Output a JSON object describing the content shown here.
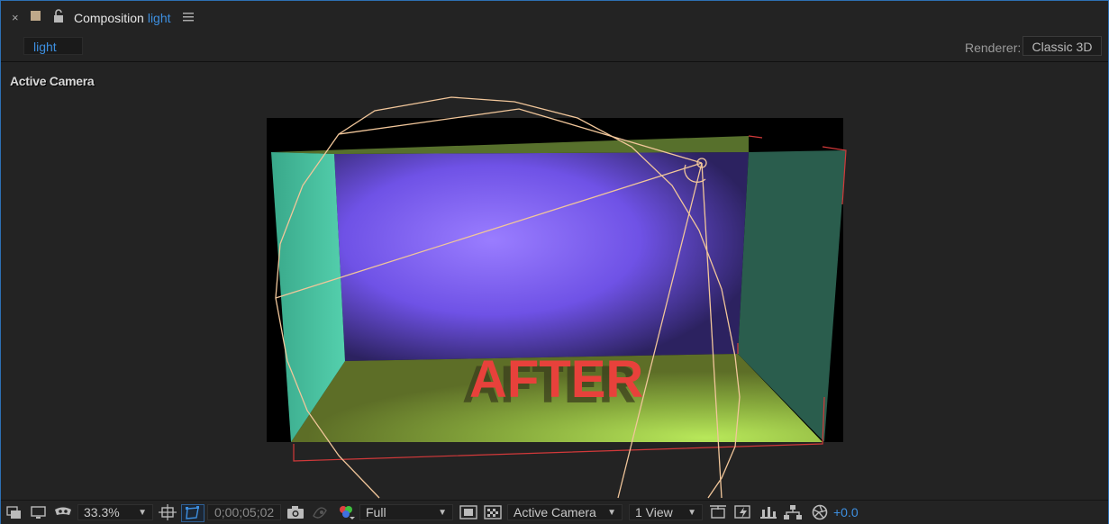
{
  "tab": {
    "close_glyph": "×",
    "label": "Composition",
    "comp_name": "light",
    "swatch_color": "#bfa98a"
  },
  "subbar": {
    "comp_chip": "light",
    "renderer_label": "Renderer:",
    "renderer_value": "Classic 3D"
  },
  "viewer": {
    "view_label": "Active Camera",
    "scene_text": "AFTER",
    "scene_text_color": "#e8413b"
  },
  "toolbar": {
    "zoom": "33.3%",
    "timecode": "0;00;05;02",
    "resolution": "Full",
    "view": "Active Camera",
    "layout": "1 View",
    "exposure": "+0.0"
  },
  "colors": {
    "accent": "#3d8fe0",
    "panel_bg": "#232323",
    "camera_wire": "#f1c69a",
    "layer_bounds": "#d2393a"
  },
  "icons": [
    "close-icon",
    "lock-icon",
    "panel-menu-icon",
    "always-preview-icon",
    "monitor-icon",
    "mask-visibility-icon",
    "region-of-interest-icon",
    "transparency-grid-icon",
    "snapshot-icon",
    "show-snapshot-icon",
    "channel-icon",
    "fast-previews-icon",
    "3d-view-icon",
    "draft-3d-icon",
    "flowchart-icon",
    "reset-exposure-icon",
    "grid-guides-icon",
    "toggle-mask-icon"
  ]
}
